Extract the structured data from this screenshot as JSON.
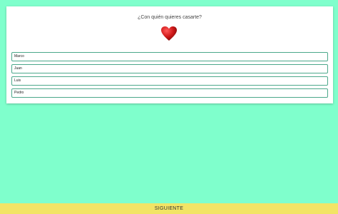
{
  "colors": {
    "page_background": "#7fffcc",
    "card_background": "#ffffff",
    "heart": "#d01818",
    "option_border": "#4ca88b",
    "next_bar": "#f2e465"
  },
  "quiz": {
    "question": "¿Con quién quieres casarte?",
    "heart_icon": "heart-icon",
    "options": [
      {
        "label": "Marco"
      },
      {
        "label": "Juan"
      },
      {
        "label": "Luis"
      },
      {
        "label": "Pedro"
      }
    ]
  },
  "footer": {
    "next_label": "SIGUIENTE"
  }
}
